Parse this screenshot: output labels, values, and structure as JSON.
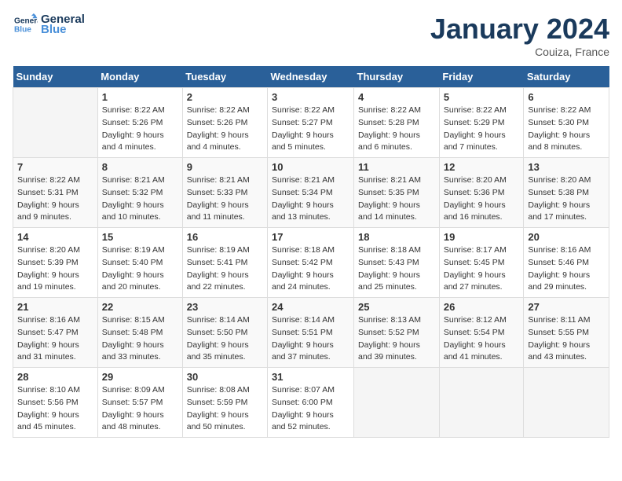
{
  "header": {
    "logo_general": "General",
    "logo_blue": "Blue",
    "month_title": "January 2024",
    "location": "Couiza, France"
  },
  "columns": [
    "Sunday",
    "Monday",
    "Tuesday",
    "Wednesday",
    "Thursday",
    "Friday",
    "Saturday"
  ],
  "weeks": [
    [
      {
        "num": "",
        "info": ""
      },
      {
        "num": "1",
        "info": "Sunrise: 8:22 AM\nSunset: 5:26 PM\nDaylight: 9 hours\nand 4 minutes."
      },
      {
        "num": "2",
        "info": "Sunrise: 8:22 AM\nSunset: 5:26 PM\nDaylight: 9 hours\nand 4 minutes."
      },
      {
        "num": "3",
        "info": "Sunrise: 8:22 AM\nSunset: 5:27 PM\nDaylight: 9 hours\nand 5 minutes."
      },
      {
        "num": "4",
        "info": "Sunrise: 8:22 AM\nSunset: 5:28 PM\nDaylight: 9 hours\nand 6 minutes."
      },
      {
        "num": "5",
        "info": "Sunrise: 8:22 AM\nSunset: 5:29 PM\nDaylight: 9 hours\nand 7 minutes."
      },
      {
        "num": "6",
        "info": "Sunrise: 8:22 AM\nSunset: 5:30 PM\nDaylight: 9 hours\nand 8 minutes."
      }
    ],
    [
      {
        "num": "7",
        "info": "Sunrise: 8:22 AM\nSunset: 5:31 PM\nDaylight: 9 hours\nand 9 minutes."
      },
      {
        "num": "8",
        "info": "Sunrise: 8:21 AM\nSunset: 5:32 PM\nDaylight: 9 hours\nand 10 minutes."
      },
      {
        "num": "9",
        "info": "Sunrise: 8:21 AM\nSunset: 5:33 PM\nDaylight: 9 hours\nand 11 minutes."
      },
      {
        "num": "10",
        "info": "Sunrise: 8:21 AM\nSunset: 5:34 PM\nDaylight: 9 hours\nand 13 minutes."
      },
      {
        "num": "11",
        "info": "Sunrise: 8:21 AM\nSunset: 5:35 PM\nDaylight: 9 hours\nand 14 minutes."
      },
      {
        "num": "12",
        "info": "Sunrise: 8:20 AM\nSunset: 5:36 PM\nDaylight: 9 hours\nand 16 minutes."
      },
      {
        "num": "13",
        "info": "Sunrise: 8:20 AM\nSunset: 5:38 PM\nDaylight: 9 hours\nand 17 minutes."
      }
    ],
    [
      {
        "num": "14",
        "info": "Sunrise: 8:20 AM\nSunset: 5:39 PM\nDaylight: 9 hours\nand 19 minutes."
      },
      {
        "num": "15",
        "info": "Sunrise: 8:19 AM\nSunset: 5:40 PM\nDaylight: 9 hours\nand 20 minutes."
      },
      {
        "num": "16",
        "info": "Sunrise: 8:19 AM\nSunset: 5:41 PM\nDaylight: 9 hours\nand 22 minutes."
      },
      {
        "num": "17",
        "info": "Sunrise: 8:18 AM\nSunset: 5:42 PM\nDaylight: 9 hours\nand 24 minutes."
      },
      {
        "num": "18",
        "info": "Sunrise: 8:18 AM\nSunset: 5:43 PM\nDaylight: 9 hours\nand 25 minutes."
      },
      {
        "num": "19",
        "info": "Sunrise: 8:17 AM\nSunset: 5:45 PM\nDaylight: 9 hours\nand 27 minutes."
      },
      {
        "num": "20",
        "info": "Sunrise: 8:16 AM\nSunset: 5:46 PM\nDaylight: 9 hours\nand 29 minutes."
      }
    ],
    [
      {
        "num": "21",
        "info": "Sunrise: 8:16 AM\nSunset: 5:47 PM\nDaylight: 9 hours\nand 31 minutes."
      },
      {
        "num": "22",
        "info": "Sunrise: 8:15 AM\nSunset: 5:48 PM\nDaylight: 9 hours\nand 33 minutes."
      },
      {
        "num": "23",
        "info": "Sunrise: 8:14 AM\nSunset: 5:50 PM\nDaylight: 9 hours\nand 35 minutes."
      },
      {
        "num": "24",
        "info": "Sunrise: 8:14 AM\nSunset: 5:51 PM\nDaylight: 9 hours\nand 37 minutes."
      },
      {
        "num": "25",
        "info": "Sunrise: 8:13 AM\nSunset: 5:52 PM\nDaylight: 9 hours\nand 39 minutes."
      },
      {
        "num": "26",
        "info": "Sunrise: 8:12 AM\nSunset: 5:54 PM\nDaylight: 9 hours\nand 41 minutes."
      },
      {
        "num": "27",
        "info": "Sunrise: 8:11 AM\nSunset: 5:55 PM\nDaylight: 9 hours\nand 43 minutes."
      }
    ],
    [
      {
        "num": "28",
        "info": "Sunrise: 8:10 AM\nSunset: 5:56 PM\nDaylight: 9 hours\nand 45 minutes."
      },
      {
        "num": "29",
        "info": "Sunrise: 8:09 AM\nSunset: 5:57 PM\nDaylight: 9 hours\nand 48 minutes."
      },
      {
        "num": "30",
        "info": "Sunrise: 8:08 AM\nSunset: 5:59 PM\nDaylight: 9 hours\nand 50 minutes."
      },
      {
        "num": "31",
        "info": "Sunrise: 8:07 AM\nSunset: 6:00 PM\nDaylight: 9 hours\nand 52 minutes."
      },
      {
        "num": "",
        "info": ""
      },
      {
        "num": "",
        "info": ""
      },
      {
        "num": "",
        "info": ""
      }
    ]
  ]
}
